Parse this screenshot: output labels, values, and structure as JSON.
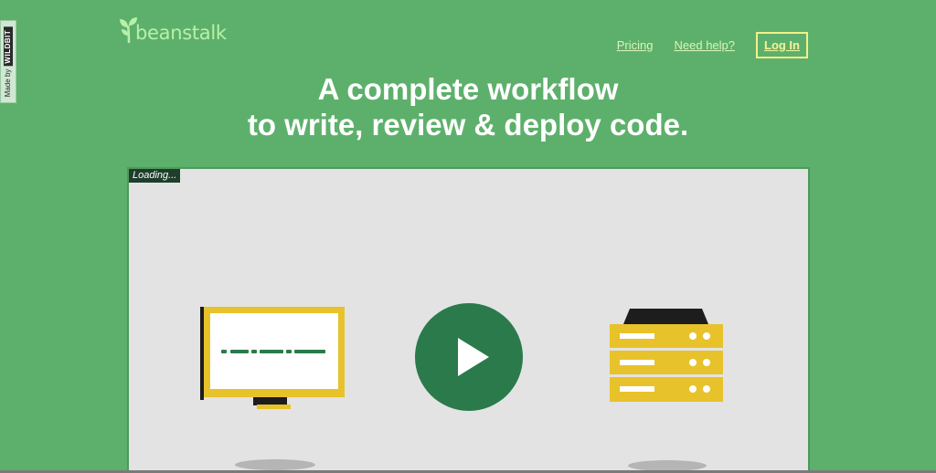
{
  "badge": {
    "made_by": "Made by",
    "brand": "WILDBIT"
  },
  "header": {
    "logo_text": "beanstalk",
    "nav": {
      "pricing": "Pricing",
      "help": "Need help?",
      "login": "Log In"
    }
  },
  "hero": {
    "line1": "A complete workflow",
    "line2": "to write, review & deploy code."
  },
  "video": {
    "loading_label": "Loading...",
    "play_icon": "play-icon",
    "monitor_icon": "monitor-icon",
    "server_icon": "server-icon"
  },
  "colors": {
    "background": "#5db06b",
    "logo_green": "#b9f0a9",
    "login_yellow": "#f3f08a",
    "play_green": "#2a7a4b",
    "illustration_yellow": "#e8c22a"
  }
}
